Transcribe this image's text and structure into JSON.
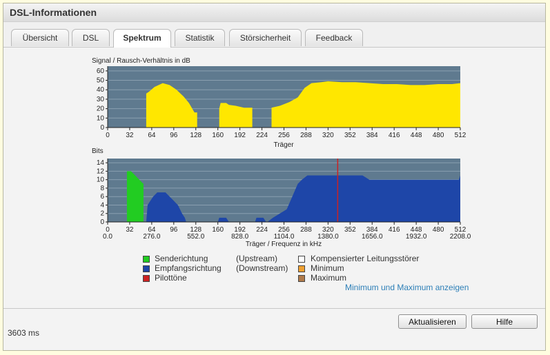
{
  "window_title": "DSL-Informationen",
  "tabs": [
    {
      "label": "Übersicht",
      "active": false
    },
    {
      "label": "DSL",
      "active": false
    },
    {
      "label": "Spektrum",
      "active": true
    },
    {
      "label": "Statistik",
      "active": false
    },
    {
      "label": "Störsicherheit",
      "active": false
    },
    {
      "label": "Feedback",
      "active": false
    }
  ],
  "snr_chart": {
    "title": "Signal / Rausch-Verhältnis in dB",
    "xlabel": "Träger",
    "y_ticks": [
      "0",
      "10",
      "20",
      "30",
      "40",
      "50",
      "60"
    ],
    "x_ticks": [
      "0",
      "32",
      "64",
      "96",
      "128",
      "160",
      "192",
      "224",
      "256",
      "288",
      "320",
      "352",
      "384",
      "416",
      "448",
      "480",
      "512"
    ]
  },
  "bits_chart": {
    "title": "Bits",
    "xlabel": "Träger / Frequenz in kHz",
    "y_ticks": [
      "0",
      "2",
      "4",
      "6",
      "8",
      "10",
      "12",
      "14"
    ],
    "x_ticks": [
      "0",
      "32",
      "64",
      "96",
      "128",
      "160",
      "192",
      "224",
      "256",
      "288",
      "320",
      "352",
      "384",
      "416",
      "448",
      "480",
      "512"
    ],
    "freq_ticks": [
      "0.0",
      "276.0",
      "552.0",
      "828.0",
      "1104.0",
      "1380.0",
      "1656.0",
      "1932.0",
      "2208.0"
    ]
  },
  "chart_data": [
    {
      "type": "area",
      "title": "Signal / Rausch-Verhältnis in dB",
      "xlabel": "Träger",
      "xlim": [
        0,
        512
      ],
      "ylim": [
        0,
        65
      ],
      "series": [
        {
          "color": "#ffe700",
          "points": [
            [
              56,
              0
            ],
            [
              56,
              36
            ],
            [
              60,
              38
            ],
            [
              68,
              43
            ],
            [
              80,
              47
            ],
            [
              90,
              45
            ],
            [
              100,
              40
            ],
            [
              110,
              33
            ],
            [
              118,
              26
            ],
            [
              126,
              16
            ],
            [
              130,
              16
            ],
            [
              130,
              0
            ],
            [
              140,
              0
            ],
            [
              142,
              0
            ],
            [
              155,
              0
            ],
            [
              160,
              0
            ],
            [
              162,
              0
            ],
            [
              162,
              20
            ],
            [
              164,
              26
            ],
            [
              172,
              26
            ],
            [
              176,
              24
            ],
            [
              186,
              23
            ],
            [
              192,
              22
            ],
            [
              198,
              21
            ],
            [
              208,
              21
            ],
            [
              210,
              21
            ],
            [
              210,
              0
            ],
            [
              238,
              0
            ],
            [
              238,
              21
            ],
            [
              250,
              23
            ],
            [
              264,
              27
            ],
            [
              276,
              32
            ],
            [
              286,
              42
            ],
            [
              296,
              47
            ],
            [
              310,
              48
            ],
            [
              320,
              49
            ],
            [
              340,
              48
            ],
            [
              360,
              48
            ],
            [
              380,
              47
            ],
            [
              400,
              46
            ],
            [
              420,
              46
            ],
            [
              440,
              45
            ],
            [
              460,
              45
            ],
            [
              480,
              46
            ],
            [
              500,
              46
            ],
            [
              512,
              47
            ],
            [
              512,
              0
            ]
          ]
        }
      ]
    },
    {
      "type": "area",
      "title": "Bits",
      "xlabel": "Träger / Frequenz in kHz",
      "xlim": [
        0,
        512
      ],
      "ylim": [
        0,
        15
      ],
      "series": [
        {
          "name": "Senderichtung",
          "color": "#22cc22",
          "points": [
            [
              28,
              0
            ],
            [
              28,
              12
            ],
            [
              34,
              12
            ],
            [
              40,
              11
            ],
            [
              46,
              10
            ],
            [
              52,
              9
            ],
            [
              52,
              0
            ]
          ]
        },
        {
          "name": "Empfangsrichtung",
          "color": "#1e46a8",
          "points": [
            [
              56,
              0
            ],
            [
              58,
              4
            ],
            [
              62,
              5
            ],
            [
              66,
              6
            ],
            [
              72,
              7
            ],
            [
              78,
              7
            ],
            [
              84,
              7
            ],
            [
              90,
              6
            ],
            [
              96,
              5
            ],
            [
              102,
              4
            ],
            [
              108,
              2
            ],
            [
              112,
              1
            ],
            [
              114,
              0
            ],
            [
              160,
              0
            ],
            [
              162,
              1
            ],
            [
              166,
              1
            ],
            [
              172,
              1
            ],
            [
              176,
              0
            ],
            [
              214,
              0
            ],
            [
              216,
              1
            ],
            [
              220,
              1
            ],
            [
              226,
              1
            ],
            [
              230,
              0
            ],
            [
              232,
              0
            ],
            [
              240,
              1
            ],
            [
              250,
              2
            ],
            [
              260,
              3
            ],
            [
              268,
              6
            ],
            [
              276,
              9
            ],
            [
              282,
              10
            ],
            [
              290,
              11
            ],
            [
              310,
              11
            ],
            [
              340,
              11
            ],
            [
              370,
              11
            ],
            [
              380,
              10
            ],
            [
              410,
              10
            ],
            [
              450,
              10
            ],
            [
              480,
              10
            ],
            [
              510,
              10
            ],
            [
              512,
              11
            ],
            [
              512,
              0
            ]
          ]
        },
        {
          "name": "Pilottöne",
          "color": "#cc2222",
          "points": [
            [
              334,
              0
            ],
            [
              334,
              15
            ]
          ]
        }
      ]
    }
  ],
  "legend": {
    "left": [
      {
        "label": "Senderichtung",
        "direction": "(Upstream)",
        "color": "#22cc22"
      },
      {
        "label": "Empfangsrichtung",
        "direction": "(Downstream)",
        "color": "#1e46a8"
      },
      {
        "label": "Pilottöne",
        "direction": "",
        "color": "#cc2222"
      }
    ],
    "right": [
      {
        "label": "Kompensierter Leitungsstörer",
        "color": "#ffffff"
      },
      {
        "label": "Minimum",
        "color": "#f0a030"
      },
      {
        "label": "Maximum",
        "color": "#b07a4a"
      }
    ]
  },
  "minmax_link": "Minimum und Maximum anzeigen",
  "buttons": {
    "refresh": "Aktualisieren",
    "help": "Hilfe"
  },
  "status_time": "3603 ms"
}
